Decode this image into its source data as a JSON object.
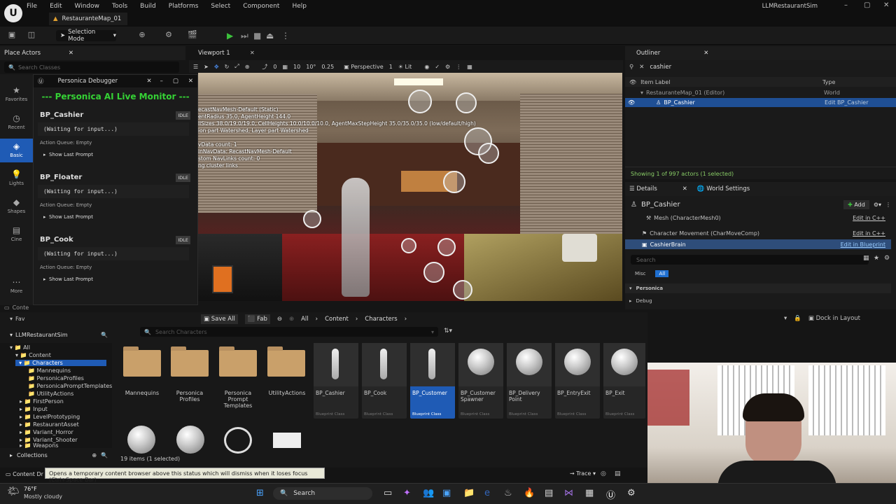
{
  "app": {
    "window_title": "LLMRestaurantSim",
    "map_tab": "RestauranteMap_01",
    "menu": [
      "File",
      "Edit",
      "Window",
      "Tools",
      "Build",
      "Platforms",
      "Select",
      "Component",
      "Help"
    ],
    "selection_mode": "Selection Mode"
  },
  "left_panel": {
    "title": "Place Actors",
    "search_placeholder": "Search Classes",
    "categories": [
      {
        "label": "Favorites",
        "icon": "star-icon"
      },
      {
        "label": "Recent",
        "icon": "clock-icon"
      },
      {
        "label": "Basic",
        "icon": "cube-icon",
        "selected": true
      },
      {
        "label": "Lights",
        "icon": "bulb-icon"
      },
      {
        "label": "Shapes",
        "icon": "shapes-icon"
      },
      {
        "label": "Cine",
        "icon": "film-icon"
      },
      {
        "label": "More",
        "icon": "more-icon"
      }
    ]
  },
  "debugger": {
    "title": "Personica Debugger",
    "monitor": "--- Personica AI Live Monitor ---",
    "agents": [
      {
        "name": "BP_Cashier",
        "status": "IDLE",
        "input": "(Waiting for input...)",
        "queue": "Action Queue: Empty",
        "last": "Show Last Prompt"
      },
      {
        "name": "BP_Floater",
        "status": "IDLE",
        "input": "(Waiting for input...)",
        "queue": "Action Queue: Empty",
        "last": "Show Last Prompt"
      },
      {
        "name": "BP_Cook",
        "status": "IDLE",
        "input": "(Waiting for input...)",
        "queue": "Action Queue: Empty",
        "last": "Show Last Prompt"
      }
    ]
  },
  "viewport": {
    "tab": "Viewport 1",
    "perspective": "Perspective",
    "lit": "Lit",
    "snap_translate": "10",
    "snap_rotate": "10°",
    "snap_scale": "0.25",
    "camera_speed": "1",
    "fov": "0",
    "debug_lines": [
      "ecastNavMesh-Default (Static)",
      "entRadius 35.0, AgentHeight 144.0",
      "llSizes 38.0/19.0/19.0, CellHeights 10.0/10.0/10.0, AgentMaxStepHeight 35.0/35.0/35.0 (low/default/high)",
      "ion part Watershed, Layer part Watershed",
      "",
      "vData count: 1",
      "inNavData: RecastNavMesh-Default",
      "stom NavLinks count: 0",
      "ng cluster links"
    ]
  },
  "outliner": {
    "title": "Outliner",
    "search": "cashier",
    "col_label": "Item Label",
    "col_type": "Type",
    "rows": [
      {
        "label": "RestauranteMap_01 (Editor)",
        "type": "World"
      },
      {
        "label": "BP_Cashier",
        "type": "Edit BP_Cashier"
      }
    ],
    "status": "Showing 1 of 997 actors (1 selected)"
  },
  "details": {
    "tab1": "Details",
    "tab2": "World Settings",
    "actor": "BP_Cashier",
    "add": "Add",
    "components": [
      {
        "label": "Mesh (CharacterMesh0)",
        "action": "Edit in C++"
      },
      {
        "label": "Character Movement (CharMoveComp)",
        "action": "Edit in C++"
      },
      {
        "label": "CashierBrain",
        "action": "Edit in Blueprint"
      }
    ],
    "search_placeholder": "Search",
    "filters": [
      "Misc",
      "All"
    ],
    "sections": [
      "Personica",
      "Debug"
    ]
  },
  "content_browser": {
    "save_all": "Save All",
    "fab": "Fab",
    "breadcrumb": [
      "All",
      "Content",
      "Characters"
    ],
    "dock": "Dock in Layout",
    "project": "LLMRestaurantSim",
    "search_placeholder": "Search Characters",
    "tree": [
      "All",
      "Content",
      "Characters",
      "Mannequins",
      "PersonicaProfiles",
      "PersonicaPromptTemplates",
      "UtilityActions",
      "FirstPerson",
      "Input",
      "LevelPrototyping",
      "RestaurantAsset",
      "Variant_Horror",
      "Variant_Shooter",
      "Weapons"
    ],
    "folders": [
      "Mannequins",
      "Personica Profiles",
      "Personica Prompt Templates",
      "UtilityActions"
    ],
    "assets": [
      {
        "label": "BP_Cashier",
        "cls": "Blueprint Class",
        "kind": "mannequin"
      },
      {
        "label": "BP_Cook",
        "cls": "Blueprint Class",
        "kind": "mannequin"
      },
      {
        "label": "BP_Customer",
        "cls": "Blueprint Class",
        "kind": "mannequin",
        "selected": true
      },
      {
        "label": "BP_Customer Spawner",
        "cls": "Blueprint Class",
        "kind": "sphere"
      },
      {
        "label": "BP_Delivery Point",
        "cls": "Blueprint Class",
        "kind": "sphere"
      },
      {
        "label": "BP_EntryExit",
        "cls": "Blueprint Class",
        "kind": "sphere"
      },
      {
        "label": "BP_Exit",
        "cls": "Blueprint Class",
        "kind": "sphere"
      }
    ],
    "collections": "Collections",
    "count": "19 items (1 selected)",
    "content_drawer": "Content Dr",
    "tooltip": "Opens a temporary content browser above this status which will dismiss when it loses focus (Ctrl+Space Bar)",
    "trace": "Trace",
    "dock_left": "Fav",
    "conte": "Conte"
  },
  "taskbar": {
    "weather_temp": "76°F",
    "weather_desc": "Mostly cloudy",
    "search": "Search"
  }
}
